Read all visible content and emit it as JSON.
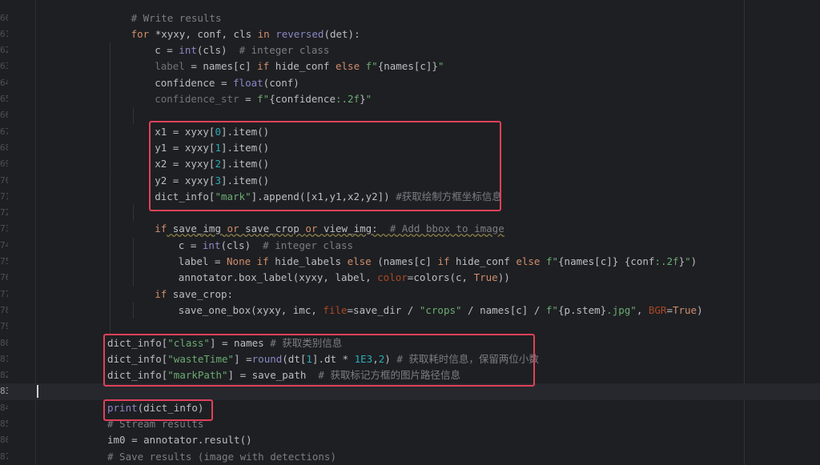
{
  "editor": {
    "caret_line": "83",
    "lines": [
      {
        "num": "60",
        "indent": 1,
        "tokens": [
          {
            "t": "# Write results",
            "c": "cmt"
          }
        ]
      },
      {
        "num": "61",
        "indent": 1,
        "tokens": [
          {
            "t": "for",
            "c": "kw"
          },
          {
            "t": " *xyxy, conf, cls "
          },
          {
            "t": "in",
            "c": "kw"
          },
          {
            "t": " "
          },
          {
            "t": "reversed",
            "c": "bi"
          },
          {
            "t": "(det):"
          }
        ]
      },
      {
        "num": "62",
        "indent": 2,
        "tokens": [
          {
            "t": "c = "
          },
          {
            "t": "int",
            "c": "bi"
          },
          {
            "t": "(cls)  "
          },
          {
            "t": "# integer class",
            "c": "cmt"
          }
        ]
      },
      {
        "num": "63",
        "indent": 2,
        "tokens": [
          {
            "t": "label",
            "c": "mut"
          },
          {
            "t": " = names[c] "
          },
          {
            "t": "if",
            "c": "kw"
          },
          {
            "t": " hide_conf "
          },
          {
            "t": "else",
            "c": "kw"
          },
          {
            "t": " "
          },
          {
            "t": "f\"",
            "c": "str"
          },
          {
            "t": "{names[c]}"
          },
          {
            "t": "\"",
            "c": "str"
          }
        ]
      },
      {
        "num": "64",
        "indent": 2,
        "tokens": [
          {
            "t": "confidence = "
          },
          {
            "t": "float",
            "c": "bi"
          },
          {
            "t": "(conf)"
          }
        ]
      },
      {
        "num": "65",
        "indent": 2,
        "tokens": [
          {
            "t": "confidence_str",
            "c": "mut"
          },
          {
            "t": " = "
          },
          {
            "t": "f\"",
            "c": "str"
          },
          {
            "t": "{confidence"
          },
          {
            "t": ":.2f",
            "c": "str"
          },
          {
            "t": "}"
          },
          {
            "t": "\"",
            "c": "str"
          }
        ]
      },
      {
        "num": "66",
        "indent": 2,
        "tokens": []
      },
      {
        "num": "67",
        "indent": 2,
        "tokens": [
          {
            "t": "x1 = xyxy["
          },
          {
            "t": "0",
            "c": "num"
          },
          {
            "t": "].item()"
          }
        ]
      },
      {
        "num": "68",
        "indent": 2,
        "tokens": [
          {
            "t": "y1 = xyxy["
          },
          {
            "t": "1",
            "c": "num"
          },
          {
            "t": "].item()"
          }
        ]
      },
      {
        "num": "69",
        "indent": 2,
        "tokens": [
          {
            "t": "x2 = xyxy["
          },
          {
            "t": "2",
            "c": "num"
          },
          {
            "t": "].item()"
          }
        ]
      },
      {
        "num": "70",
        "indent": 2,
        "tokens": [
          {
            "t": "y2 = xyxy["
          },
          {
            "t": "3",
            "c": "num"
          },
          {
            "t": "].item()"
          }
        ]
      },
      {
        "num": "71",
        "indent": 2,
        "tokens": [
          {
            "t": "dict_info["
          },
          {
            "t": "\"mark\"",
            "c": "str"
          },
          {
            "t": "].append([x1,y1,x2,y2]) "
          },
          {
            "t": "#获取绘制方框坐标信息",
            "c": "cmt"
          }
        ]
      },
      {
        "num": "72",
        "indent": 2,
        "tokens": []
      },
      {
        "num": "73",
        "indent": 2,
        "tokens": [
          {
            "t": "if",
            "c": "kw"
          },
          {
            "t": " save_img ",
            "w": true
          },
          {
            "t": "or",
            "c": "kw",
            "w": true
          },
          {
            "t": " save_crop ",
            "w": true
          },
          {
            "t": "or",
            "c": "kw",
            "w": true
          },
          {
            "t": " view_img:  ",
            "w": true
          },
          {
            "t": "# Add bbox to image",
            "c": "cmt",
            "w": true
          }
        ]
      },
      {
        "num": "74",
        "indent": 3,
        "tokens": [
          {
            "t": "c = "
          },
          {
            "t": "int",
            "c": "bi"
          },
          {
            "t": "(cls)  "
          },
          {
            "t": "# integer class",
            "c": "cmt"
          }
        ]
      },
      {
        "num": "75",
        "indent": 3,
        "tokens": [
          {
            "t": "label = "
          },
          {
            "t": "None",
            "c": "kw"
          },
          {
            "t": " "
          },
          {
            "t": "if",
            "c": "kw"
          },
          {
            "t": " hide_labels "
          },
          {
            "t": "else",
            "c": "kw"
          },
          {
            "t": " (names[c] "
          },
          {
            "t": "if",
            "c": "kw"
          },
          {
            "t": " hide_conf "
          },
          {
            "t": "else",
            "c": "kw"
          },
          {
            "t": " "
          },
          {
            "t": "f\"",
            "c": "str"
          },
          {
            "t": "{names[c]}"
          },
          {
            "t": " ",
            "c": "str"
          },
          {
            "t": "{conf"
          },
          {
            "t": ":.2f",
            "c": "str"
          },
          {
            "t": "}"
          },
          {
            "t": "\"",
            "c": "str"
          },
          {
            "t": ")"
          }
        ]
      },
      {
        "num": "76",
        "indent": 3,
        "tokens": [
          {
            "t": "annotator.box_label(xyxy, label, "
          },
          {
            "t": "color",
            "c": "pm"
          },
          {
            "t": "=colors(c, "
          },
          {
            "t": "True",
            "c": "kw"
          },
          {
            "t": "))"
          }
        ]
      },
      {
        "num": "77",
        "indent": 2,
        "tokens": [
          {
            "t": "if",
            "c": "kw"
          },
          {
            "t": " save_crop:"
          }
        ]
      },
      {
        "num": "78",
        "indent": 3,
        "tokens": [
          {
            "t": "save_one_box(xyxy, imc, "
          },
          {
            "t": "file",
            "c": "pm"
          },
          {
            "t": "=save_dir / "
          },
          {
            "t": "\"crops\"",
            "c": "str"
          },
          {
            "t": " / names[c] / "
          },
          {
            "t": "f\"",
            "c": "str"
          },
          {
            "t": "{p.stem}"
          },
          {
            "t": ".jpg\"",
            "c": "str"
          },
          {
            "t": ", "
          },
          {
            "t": "BGR",
            "c": "pm"
          },
          {
            "t": "="
          },
          {
            "t": "True",
            "c": "kw"
          },
          {
            "t": ")"
          }
        ]
      },
      {
        "num": "79",
        "indent": 1,
        "tokens": []
      },
      {
        "num": "80",
        "indent": 0,
        "tokens": [
          {
            "t": "dict_info["
          },
          {
            "t": "\"class\"",
            "c": "str"
          },
          {
            "t": "] = names "
          },
          {
            "t": "# 获取类别信息",
            "c": "cmt"
          }
        ]
      },
      {
        "num": "81",
        "indent": 0,
        "tokens": [
          {
            "t": "dict_info["
          },
          {
            "t": "\"wasteTime\"",
            "c": "str"
          },
          {
            "t": "] ="
          },
          {
            "t": "round",
            "c": "bi"
          },
          {
            "t": "(dt["
          },
          {
            "t": "1",
            "c": "num"
          },
          {
            "t": "].dt * "
          },
          {
            "t": "1E3",
            "c": "num"
          },
          {
            "t": ","
          },
          {
            "t": "2",
            "c": "num"
          },
          {
            "t": ") "
          },
          {
            "t": "# 获取耗时信息，保留两位小数",
            "c": "cmt"
          }
        ]
      },
      {
        "num": "82",
        "indent": 0,
        "tokens": [
          {
            "t": "dict_info["
          },
          {
            "t": "\"markPath\"",
            "c": "str"
          },
          {
            "t": "] = save_path  "
          },
          {
            "t": "# 获取标记方框的图片路径信息",
            "c": "cmt"
          }
        ]
      },
      {
        "num": "83",
        "indent": 0,
        "tokens": []
      },
      {
        "num": "84",
        "indent": 0,
        "tokens": [
          {
            "t": "print",
            "c": "bi"
          },
          {
            "t": "(dict_info)"
          }
        ]
      },
      {
        "num": "85",
        "indent": 0,
        "tokens": [
          {
            "t": "# Stream results",
            "c": "cmt"
          }
        ]
      },
      {
        "num": "86",
        "indent": 0,
        "tokens": [
          {
            "t": "im0 = annotator.result()"
          }
        ]
      },
      {
        "num": "87",
        "indent": 0,
        "tokens": [
          {
            "t": "# Save results (image with detections)",
            "c": "cmt"
          }
        ]
      }
    ]
  },
  "colors": {
    "background": "#1e1f22",
    "highlight_box": "#e0415a",
    "keyword": "#cf8e6d",
    "string": "#6aab73",
    "number": "#2aacb8",
    "comment": "#7a7e85",
    "builtin": "#8888c6"
  }
}
